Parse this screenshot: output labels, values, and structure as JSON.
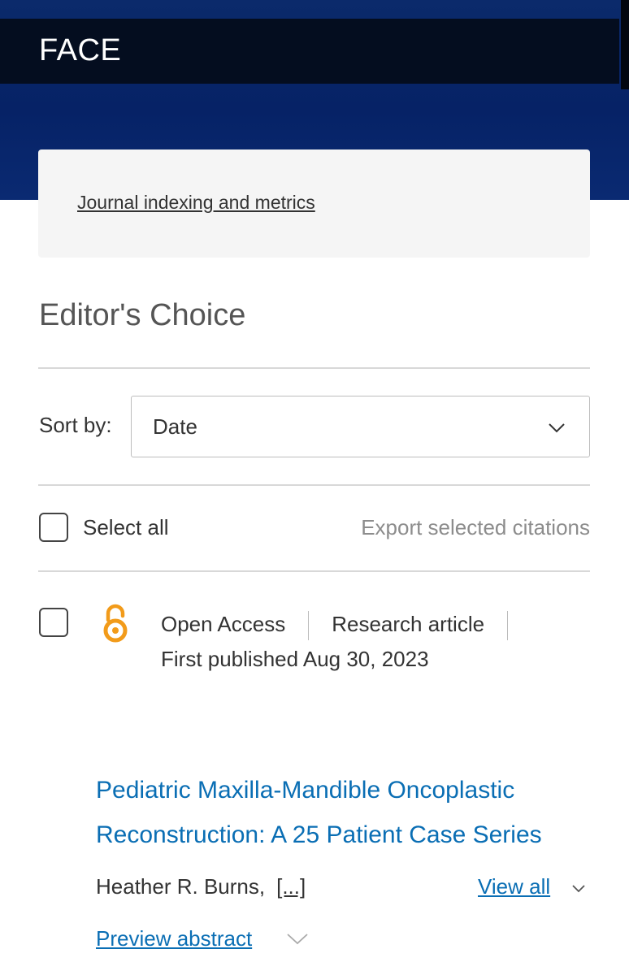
{
  "header": {
    "brand": "FACE"
  },
  "info_card": {
    "link": "Journal indexing and metrics"
  },
  "section": {
    "title": "Editor's Choice"
  },
  "sort": {
    "label": "Sort by:",
    "value": "Date"
  },
  "toolbar": {
    "select_all": "Select all",
    "export": "Export selected citations"
  },
  "article": {
    "access": "Open Access",
    "type": "Research article",
    "published": "First published Aug 30, 2023",
    "title": "Pediatric Maxilla-Mandible Oncoplastic Reconstruction: A 25 Patient Case Series",
    "author": "Heather R. Burns",
    "author_sep": ",",
    "more_authors": "[...]",
    "view_all": "View all",
    "preview": "Preview abstract"
  },
  "icons": {
    "open_access": "open-access-icon",
    "chevron": "chevron-down-icon"
  },
  "colors": {
    "hero": "#062266",
    "titlebar": "#040d1f",
    "link": "#0a6eb4",
    "open_access": "#f29b1a"
  }
}
